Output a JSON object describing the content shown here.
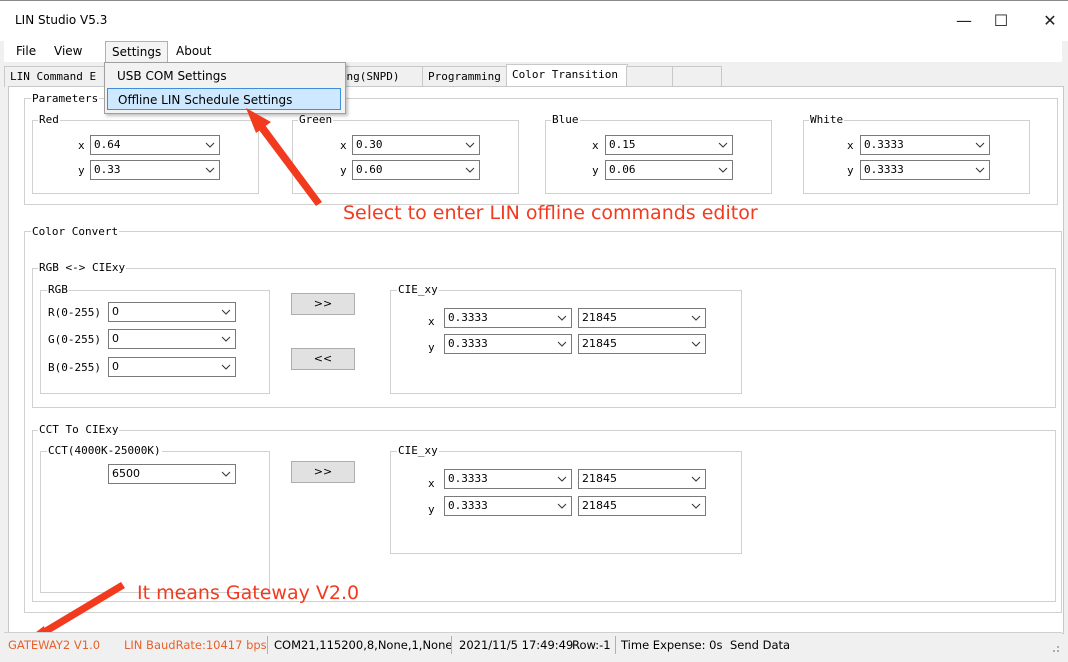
{
  "window": {
    "title": "LIN Studio V5.3"
  },
  "menu": [
    "File",
    "View",
    "Settings",
    "About"
  ],
  "settings_menu": [
    "USB COM Settings",
    "Offline LIN Schedule Settings"
  ],
  "tabs": [
    "LIN Command E",
    "essing(SNPD)",
    "Programming",
    "Color Transition"
  ],
  "parameters": {
    "label": "Parameters",
    "groups": [
      {
        "name": "Red",
        "x": "0.64",
        "y": "0.33"
      },
      {
        "name": "Green",
        "x": "0.30",
        "y": "0.60"
      },
      {
        "name": "Blue",
        "x": "0.15",
        "y": "0.06"
      },
      {
        "name": "White",
        "x": "0.3333",
        "y": "0.3333"
      }
    ],
    "x_label": "x",
    "y_label": "y"
  },
  "color_convert": {
    "label": "Color Convert",
    "rgb_cie": {
      "label": "RGB <-> CIExy",
      "rgb": {
        "label": "RGB",
        "r_label": "R(0-255)",
        "g_label": "G(0-255)",
        "b_label": "B(0-255)",
        "r": "0",
        "g": "0",
        "b": "0"
      },
      "to_cie_button": ">>",
      "to_rgb_button": "<<",
      "cie": {
        "label": "CIE_xy",
        "x": "0.3333",
        "x_raw": "21845",
        "y": "0.3333",
        "y_raw": "21845"
      }
    },
    "cct_cie": {
      "label": "CCT To CIExy",
      "cct": {
        "label": "CCT(4000K-25000K)",
        "value": "6500"
      },
      "to_cie_button": ">>",
      "cie": {
        "label": "CIE_xy",
        "x": "0.3333",
        "x_raw": "21845",
        "y": "0.3333",
        "y_raw": "21845"
      }
    }
  },
  "annotations": {
    "settings": "Select to enter LIN offline commands editor",
    "gateway": "It means Gateway V2.0"
  },
  "statusbar": {
    "gateway": "GATEWAY2  V1.0",
    "baud": "LIN BaudRate:10417 bps",
    "com": "COM21,115200,8,None,1,None",
    "time": "2021/11/5 17:49:49",
    "row": "Row:-1",
    "expense": "Time Expense: 0s",
    "send": "Send Data"
  },
  "colors": {
    "annotation": "#f23a1e",
    "status_orange": "#e8612c",
    "highlight": "#cde8ff"
  }
}
